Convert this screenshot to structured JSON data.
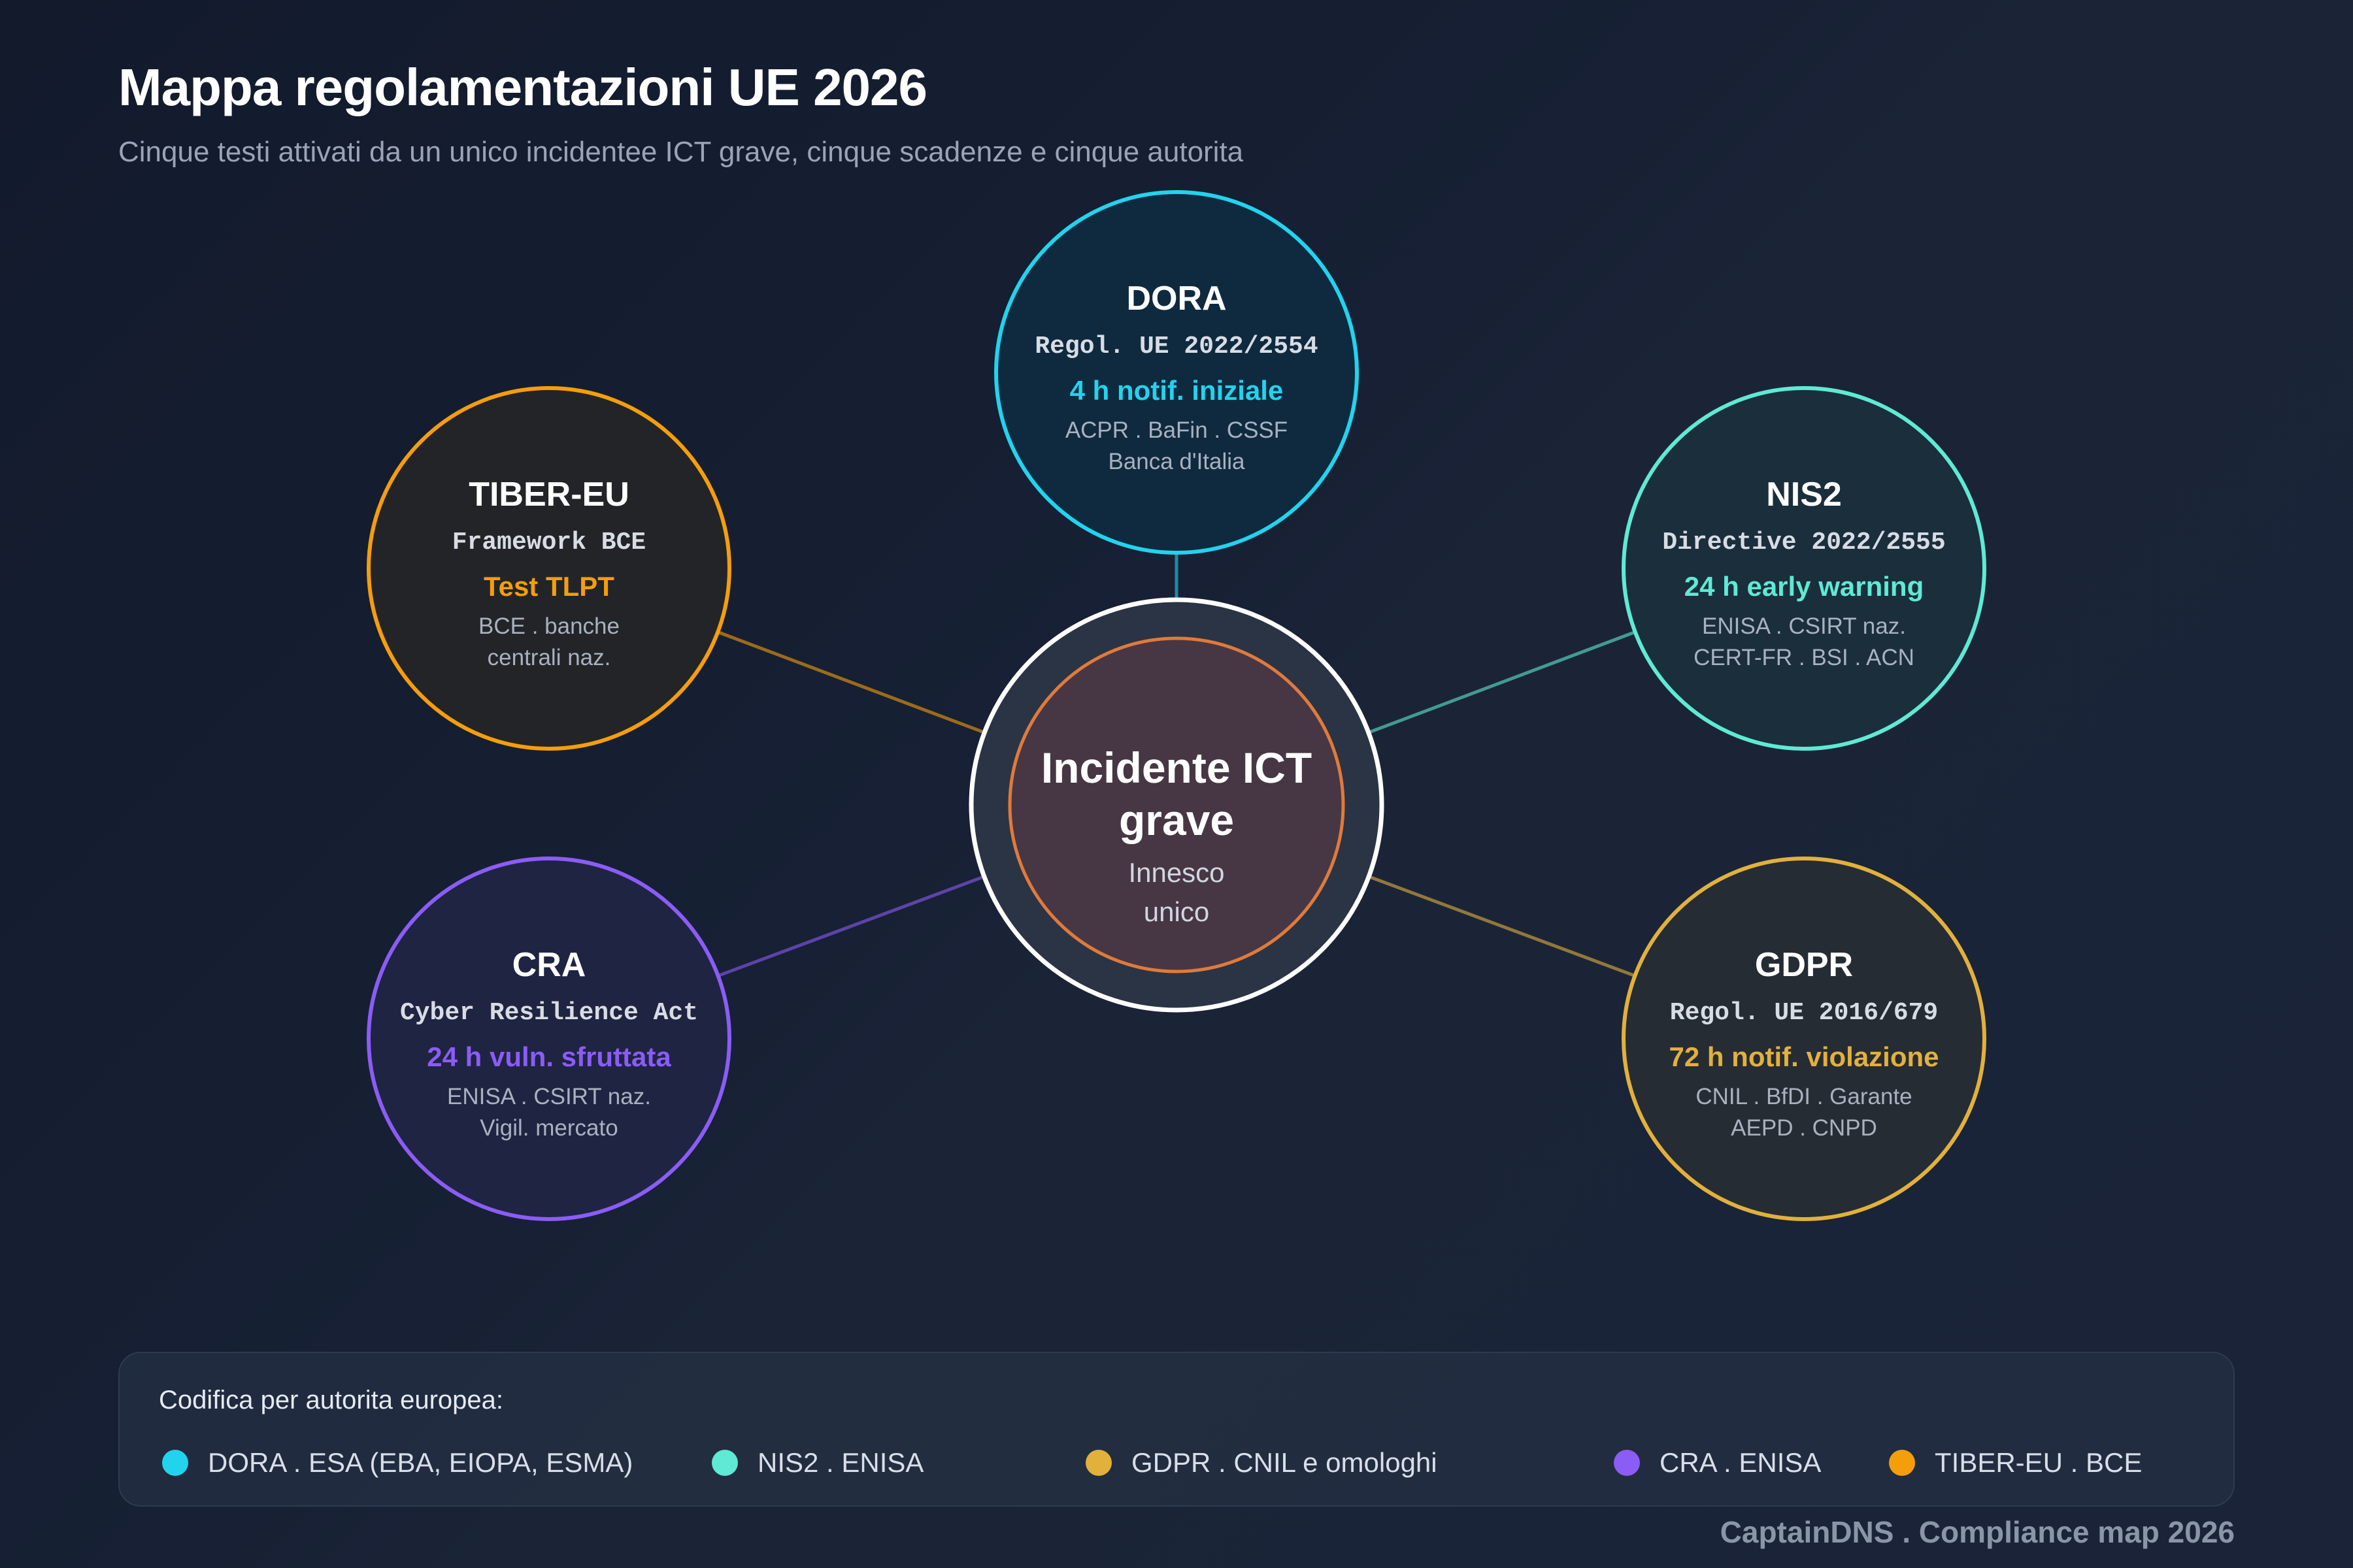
{
  "title": "Mappa regolamentazioni UE 2026",
  "subtitle": "Cinque testi attivati da un unico incidentee ICT grave, cinque scadenze e cinque autorita",
  "center": {
    "title_line1": "Incidente ICT",
    "title_line2": "grave",
    "sub_line1": "Innesco",
    "sub_line2": "unico",
    "ring_color": "#ffffff",
    "inner_color": "#e07a3c"
  },
  "nodes": [
    {
      "id": "dora",
      "name": "DORA",
      "reference": "Regol. UE 2022/2554",
      "deadline": "4 h notif. iniziale",
      "authorities": [
        "ACPR . BaFin . CSSF",
        "Banca d'Italia"
      ],
      "color": "#22d3ee",
      "fill": "#0f2a3f"
    },
    {
      "id": "nis2",
      "name": "NIS2",
      "reference": "Directive 2022/2555",
      "deadline": "24 h early warning",
      "authorities": [
        "ENISA . CSIRT naz.",
        "CERT-FR . BSI . ACN"
      ],
      "color": "#5eead4",
      "fill": "#1a2e3c"
    },
    {
      "id": "gdpr",
      "name": "GDPR",
      "reference": "Regol. UE 2016/679",
      "deadline": "72 h notif. violazione",
      "authorities": [
        "CNIL . BfDI . Garante",
        "AEPD . CNPD"
      ],
      "color": "#e2b13c",
      "fill": "#262c34"
    },
    {
      "id": "cra",
      "name": "CRA",
      "reference": "Cyber Resilience Act",
      "deadline": "24 h vuln. sfruttata",
      "authorities": [
        "ENISA . CSIRT naz.",
        "Vigil. mercato"
      ],
      "color": "#8b5cf6",
      "fill": "#1f2442"
    },
    {
      "id": "tiber",
      "name": "TIBER-EU",
      "reference": "Framework BCE",
      "deadline": "Test TLPT",
      "authorities": [
        "BCE . banche",
        "centrali naz."
      ],
      "color": "#f59e0b",
      "fill": "#232428"
    }
  ],
  "legend": {
    "title": "Codifica per autorita europea:",
    "items": [
      {
        "label": "DORA . ESA (EBA, EIOPA, ESMA)",
        "color": "#22d3ee"
      },
      {
        "label": "NIS2 . ENISA",
        "color": "#5eead4"
      },
      {
        "label": "GDPR . CNIL e omologhi",
        "color": "#e2b13c"
      },
      {
        "label": "CRA . ENISA",
        "color": "#8b5cf6"
      },
      {
        "label": "TIBER-EU . BCE",
        "color": "#f59e0b"
      }
    ]
  },
  "footer": "CaptainDNS . Compliance map 2026"
}
